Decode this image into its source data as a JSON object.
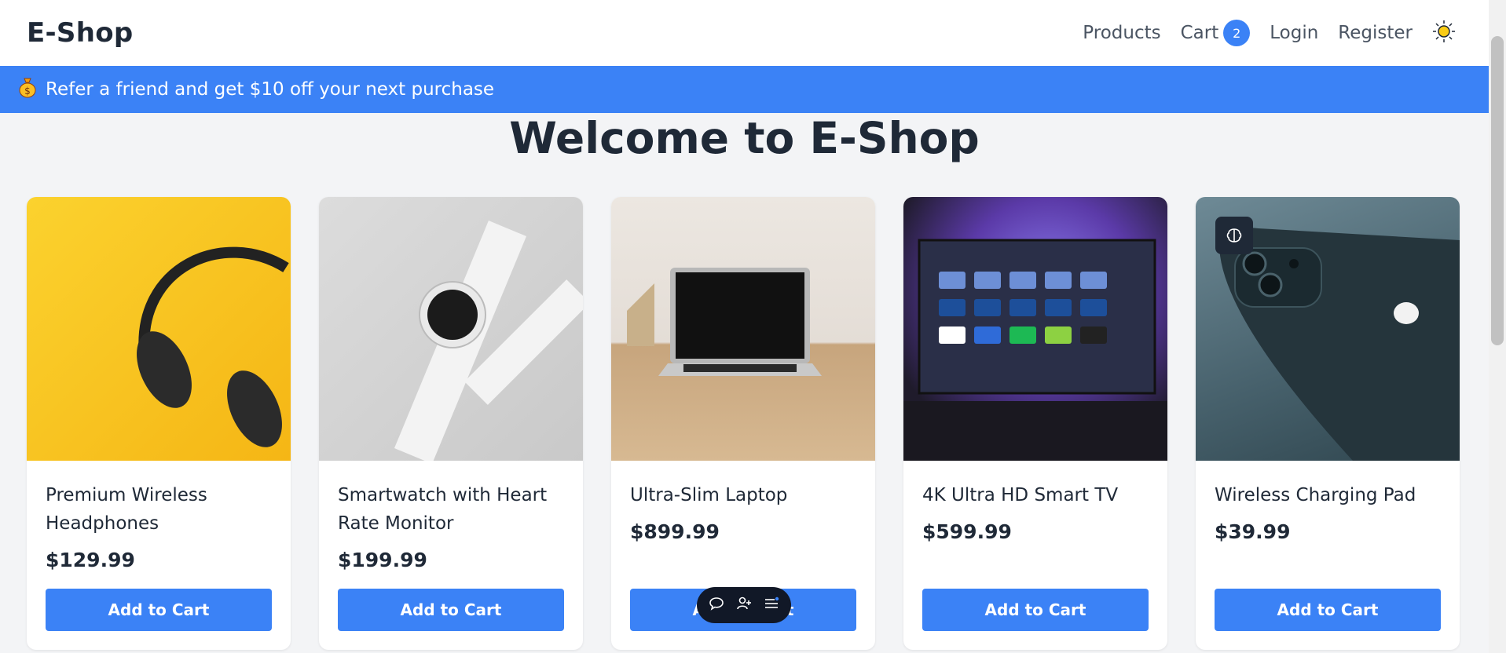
{
  "nav": {
    "brand": "E-Shop",
    "links": [
      "Products",
      "Cart",
      "Login",
      "Register"
    ],
    "cart_count": "2",
    "theme_icon": "sun-icon"
  },
  "promo": {
    "icon": "money-bag-icon",
    "text": "Refer a friend and get $10 off your next purchase"
  },
  "page": {
    "title": "Welcome to E-Shop"
  },
  "products": [
    {
      "name": "Premium Wireless Headphones",
      "price": "$129.99",
      "button": "Add to Cart"
    },
    {
      "name": "Smartwatch with Heart Rate Monitor",
      "price": "$199.99",
      "button": "Add to Cart"
    },
    {
      "name": "Ultra-Slim Laptop",
      "price": "$899.99",
      "button": "Add to Cart"
    },
    {
      "name": "4K Ultra HD Smart TV",
      "price": "$599.99",
      "button": "Add to Cart"
    },
    {
      "name": "Wireless Charging Pad",
      "price": "$39.99",
      "button": "Add to Cart"
    }
  ],
  "floating_toolbar": {
    "icons": [
      "chat-icon",
      "add-user-icon",
      "menu-icon"
    ]
  },
  "colors": {
    "accent": "#3b82f6",
    "background": "#f3f4f6",
    "text": "#1f2937"
  }
}
